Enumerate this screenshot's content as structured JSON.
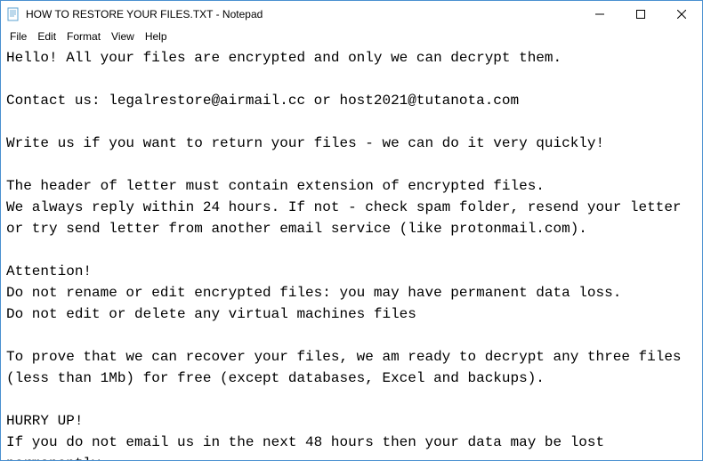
{
  "window": {
    "title": "HOW TO RESTORE YOUR FILES.TXT - Notepad"
  },
  "menu": {
    "file": "File",
    "edit": "Edit",
    "format": "Format",
    "view": "View",
    "help": "Help"
  },
  "content": {
    "text": "Hello! All your files are encrypted and only we can decrypt them.\n\nContact us: legalrestore@airmail.cc or host2021@tutanota.com\n\nWrite us if you want to return your files - we can do it very quickly!\n\nThe header of letter must contain extension of encrypted files.\nWe always reply within 24 hours. If not - check spam folder, resend your letter or try send letter from another email service (like protonmail.com).\n\nAttention!\nDo not rename or edit encrypted files: you may have permanent data loss.\nDo not edit or delete any virtual machines files\n\nTo prove that we can recover your files, we am ready to decrypt any three files (less than 1Mb) for free (except databases, Excel and backups).\n\nHURRY UP!\nIf you do not email us in the next 48 hours then your data may be lost permanently."
  },
  "controls": {
    "minimize": "—",
    "maximize": "☐",
    "close": "✕"
  }
}
